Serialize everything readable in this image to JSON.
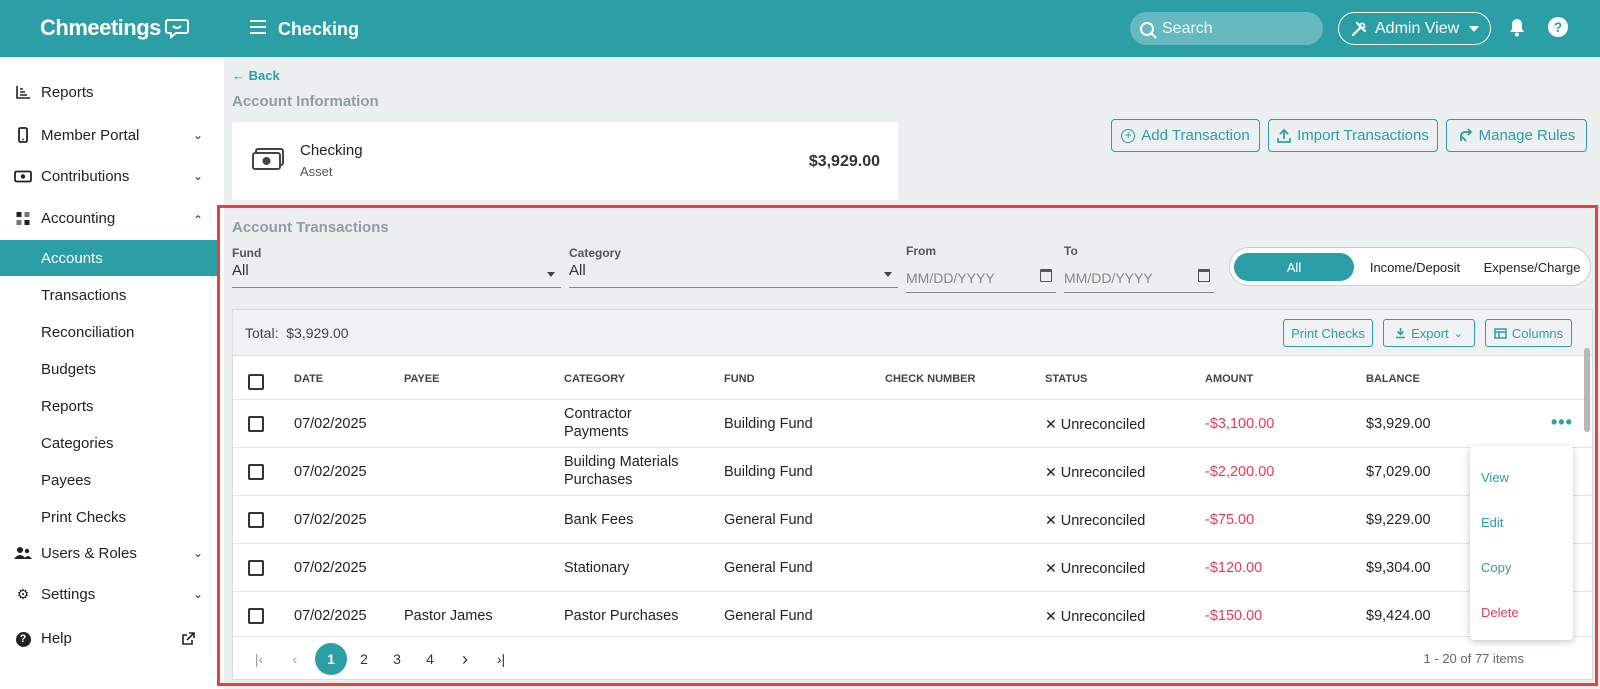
{
  "app": {
    "logo": "Chmeetings",
    "page_title": "Checking"
  },
  "topbar": {
    "search_placeholder": "Search",
    "admin_view": "Admin View",
    "help": "?"
  },
  "sidebar": {
    "items": [
      {
        "label": "Reports"
      },
      {
        "label": "Member Portal"
      },
      {
        "label": "Contributions"
      },
      {
        "label": "Accounting"
      },
      {
        "label": "Users & Roles"
      },
      {
        "label": "Settings"
      },
      {
        "label": "Help"
      }
    ],
    "accounting_sub": [
      {
        "label": "Accounts",
        "active": true
      },
      {
        "label": "Transactions"
      },
      {
        "label": "Reconciliation"
      },
      {
        "label": "Budgets"
      },
      {
        "label": "Reports"
      },
      {
        "label": "Categories"
      },
      {
        "label": "Payees"
      },
      {
        "label": "Print Checks"
      }
    ]
  },
  "main": {
    "back": "Back",
    "account_info_title": "Account Information",
    "account": {
      "name": "Checking",
      "type": "Asset",
      "balance": "$3,929.00"
    },
    "actions": {
      "add": "Add Transaction",
      "import": "Import Transactions",
      "rules": "Manage Rules"
    },
    "transactions_title": "Account Transactions",
    "filters": {
      "fund_label": "Fund",
      "fund_value": "All",
      "category_label": "Category",
      "category_value": "All",
      "from_label": "From",
      "from_placeholder": "MM/DD/YYYY",
      "to_label": "To",
      "to_placeholder": "MM/DD/YYYY",
      "type_options": [
        "All",
        "Income/Deposit",
        "Expense/Charge"
      ],
      "type_selected": "All"
    },
    "table": {
      "total_label": "Total:",
      "total_value": "$3,929.00",
      "print_checks": "Print Checks",
      "export": "Export",
      "columns": "Columns",
      "headers": [
        "DATE",
        "PAYEE",
        "CATEGORY",
        "FUND",
        "CHECK NUMBER",
        "STATUS",
        "AMOUNT",
        "BALANCE"
      ],
      "rows": [
        {
          "date": "07/02/2025",
          "payee": "",
          "category": "Contractor Payments",
          "fund": "Building Fund",
          "check": "",
          "status": "Unreconciled",
          "amount": "-$3,100.00",
          "balance": "$3,929.00"
        },
        {
          "date": "07/02/2025",
          "payee": "",
          "category": "Building Materials Purchases",
          "fund": "Building Fund",
          "check": "",
          "status": "Unreconciled",
          "amount": "-$2,200.00",
          "balance": "$7,029.00"
        },
        {
          "date": "07/02/2025",
          "payee": "",
          "category": "Bank Fees",
          "fund": "General Fund",
          "check": "",
          "status": "Unreconciled",
          "amount": "-$75.00",
          "balance": "$9,229.00"
        },
        {
          "date": "07/02/2025",
          "payee": "",
          "category": "Stationary",
          "fund": "General Fund",
          "check": "",
          "status": "Unreconciled",
          "amount": "-$120.00",
          "balance": "$9,304.00"
        },
        {
          "date": "07/02/2025",
          "payee": "Pastor James",
          "category": "Pastor Purchases",
          "fund": "General Fund",
          "check": "",
          "status": "Unreconciled",
          "amount": "-$150.00",
          "balance": "$9,424.00"
        }
      ],
      "pager": {
        "pages": [
          "1",
          "2",
          "3",
          "4"
        ],
        "current": "1",
        "info": "1 - 20 of 77 items"
      }
    },
    "context_menu": [
      "View",
      "Edit",
      "Copy",
      "Delete"
    ]
  },
  "colors": {
    "brand": "#2b9ea6",
    "negative": "#e53d57",
    "highlight": "#e8403f"
  },
  "icons": [
    "menu-icon",
    "search-icon",
    "tools-icon",
    "bell-icon",
    "help-icon",
    "bar-chart-icon",
    "phone-icon",
    "money-icon",
    "grid-icon",
    "users-icon",
    "gear-icon",
    "question-icon",
    "external-link-icon",
    "cash-icon",
    "plus-circle-icon",
    "upload-icon",
    "rules-icon",
    "calendar-icon",
    "download-icon",
    "table-icon",
    "ellipsis-icon",
    "close-icon"
  ]
}
